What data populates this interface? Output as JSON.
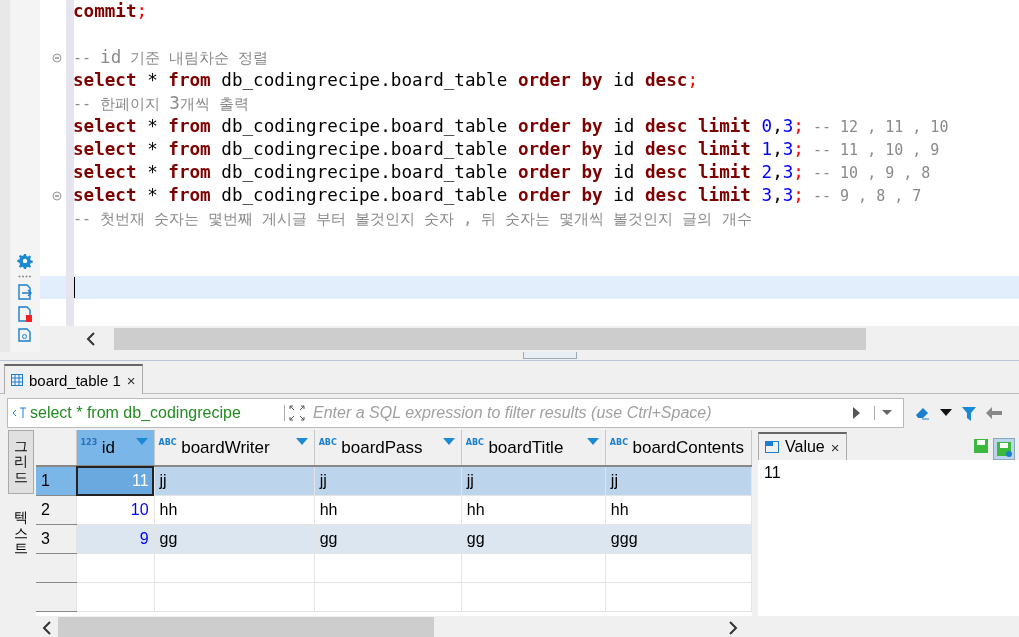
{
  "editor": {
    "lines": [
      {
        "fold": false,
        "current": false,
        "tokens": [
          {
            "kind": "keyword",
            "text": "commit"
          },
          {
            "kind": "punct",
            "text": ";"
          }
        ]
      },
      {
        "fold": false,
        "current": false
      },
      {
        "fold": true,
        "current": false,
        "tokens": [
          {
            "kind": "comment",
            "text": "-- "
          },
          {
            "kind": "commentid",
            "text": "id"
          },
          {
            "kind": "comment",
            "text": " 기준 내림차순 정렬"
          }
        ]
      },
      {
        "fold": false,
        "current": false,
        "tokens": [
          {
            "kind": "keyword",
            "text": "select"
          },
          {
            "kind": "ident",
            "text": " * "
          },
          {
            "kind": "keyword",
            "text": "from"
          },
          {
            "kind": "ident",
            "text": " db_codingrecipe.board_table "
          },
          {
            "kind": "keyword",
            "text": "order by"
          },
          {
            "kind": "ident",
            "text": " id "
          },
          {
            "kind": "keyword",
            "text": "desc"
          },
          {
            "kind": "punct",
            "text": ";"
          }
        ]
      },
      {
        "fold": false,
        "current": false,
        "tokens": [
          {
            "kind": "comment",
            "text": "-- 한페이지 "
          },
          {
            "kind": "commentid",
            "text": "3"
          },
          {
            "kind": "comment",
            "text": "개씩 출력"
          }
        ]
      },
      {
        "fold": false,
        "current": false,
        "tokens": [
          {
            "kind": "keyword",
            "text": "select"
          },
          {
            "kind": "ident",
            "text": " * "
          },
          {
            "kind": "keyword",
            "text": "from"
          },
          {
            "kind": "ident",
            "text": " db_codingrecipe.board_table "
          },
          {
            "kind": "keyword",
            "text": "order by"
          },
          {
            "kind": "ident",
            "text": " id "
          },
          {
            "kind": "keyword",
            "text": "desc limit "
          },
          {
            "kind": "number",
            "text": "0"
          },
          {
            "kind": "ident",
            "text": ","
          },
          {
            "kind": "number",
            "text": "3"
          },
          {
            "kind": "punct",
            "text": ";"
          },
          {
            "kind": "comment",
            "text": " -- 12 , 11 , 10"
          }
        ]
      },
      {
        "fold": false,
        "current": false,
        "tokens": [
          {
            "kind": "keyword",
            "text": "select"
          },
          {
            "kind": "ident",
            "text": " * "
          },
          {
            "kind": "keyword",
            "text": "from"
          },
          {
            "kind": "ident",
            "text": " db_codingrecipe.board_table "
          },
          {
            "kind": "keyword",
            "text": "order by"
          },
          {
            "kind": "ident",
            "text": " id "
          },
          {
            "kind": "keyword",
            "text": "desc limit "
          },
          {
            "kind": "number",
            "text": "1"
          },
          {
            "kind": "ident",
            "text": ","
          },
          {
            "kind": "number",
            "text": "3"
          },
          {
            "kind": "punct",
            "text": ";"
          },
          {
            "kind": "comment",
            "text": " -- 11 , 10 , 9"
          }
        ]
      },
      {
        "fold": false,
        "current": false,
        "tokens": [
          {
            "kind": "keyword",
            "text": "select"
          },
          {
            "kind": "ident",
            "text": " * "
          },
          {
            "kind": "keyword",
            "text": "from"
          },
          {
            "kind": "ident",
            "text": " db_codingrecipe.board_table "
          },
          {
            "kind": "keyword",
            "text": "order by"
          },
          {
            "kind": "ident",
            "text": " id "
          },
          {
            "kind": "keyword",
            "text": "desc limit "
          },
          {
            "kind": "number",
            "text": "2"
          },
          {
            "kind": "ident",
            "text": ","
          },
          {
            "kind": "number",
            "text": "3"
          },
          {
            "kind": "punct",
            "text": ";"
          },
          {
            "kind": "comment",
            "text": " -- 10 , 9 , 8"
          }
        ]
      },
      {
        "fold": true,
        "current": false,
        "tokens": [
          {
            "kind": "keyword",
            "text": "select"
          },
          {
            "kind": "ident",
            "text": " * "
          },
          {
            "kind": "keyword",
            "text": "from"
          },
          {
            "kind": "ident",
            "text": " db_codingrecipe.board_table "
          },
          {
            "kind": "keyword",
            "text": "order by"
          },
          {
            "kind": "ident",
            "text": " id "
          },
          {
            "kind": "keyword",
            "text": "desc limit "
          },
          {
            "kind": "number",
            "text": "3"
          },
          {
            "kind": "ident",
            "text": ","
          },
          {
            "kind": "number",
            "text": "3"
          },
          {
            "kind": "punct",
            "text": ";"
          },
          {
            "kind": "comment",
            "text": " -- 9 , 8 , 7"
          }
        ]
      },
      {
        "fold": false,
        "current": false,
        "tokens": [
          {
            "kind": "comment",
            "text": "-- 첫번재 숫자는 몇번째 게시글 부터 볼것인지 숫자 , 뒤 숫자는 몇개씩 볼것인지 글의 개수"
          }
        ]
      },
      {
        "fold": false,
        "current": false
      },
      {
        "fold": false,
        "current": false
      },
      {
        "fold": false,
        "current": true
      }
    ]
  },
  "result_tab": {
    "label": "board_table 1",
    "close": "×"
  },
  "filter": {
    "query": "select * from db_codingrecipe",
    "placeholder": "Enter a SQL expression to filter results (use Ctrl+Space)"
  },
  "side_tabs": [
    {
      "label": "그리드",
      "selected": true
    },
    {
      "label": "텍스트",
      "selected": false
    }
  ],
  "table": {
    "columns": [
      {
        "name": "id",
        "kind": "number",
        "type_label": "123",
        "selected": true
      },
      {
        "name": "boardWriter",
        "kind": "text",
        "type_label": "ABC",
        "selected": false
      },
      {
        "name": "boardPass",
        "kind": "text",
        "type_label": "ABC",
        "selected": false
      },
      {
        "name": "boardTitle",
        "kind": "text",
        "type_label": "ABC",
        "selected": false
      },
      {
        "name": "boardContents",
        "kind": "text",
        "type_label": "ABC",
        "selected": false
      }
    ],
    "rows": [
      {
        "number": "1",
        "selected": true,
        "cells": [
          "11",
          "jj",
          "jj",
          "jj",
          "jj"
        ]
      },
      {
        "number": "2",
        "selected": false,
        "cells": [
          "10",
          "hh",
          "hh",
          "hh",
          "hh"
        ]
      },
      {
        "number": "3",
        "selected": false,
        "cells": [
          "9",
          "gg",
          "gg",
          "gg",
          "ggg"
        ]
      }
    ]
  },
  "value_panel": {
    "title": "Value",
    "close": "×",
    "value": "11"
  }
}
